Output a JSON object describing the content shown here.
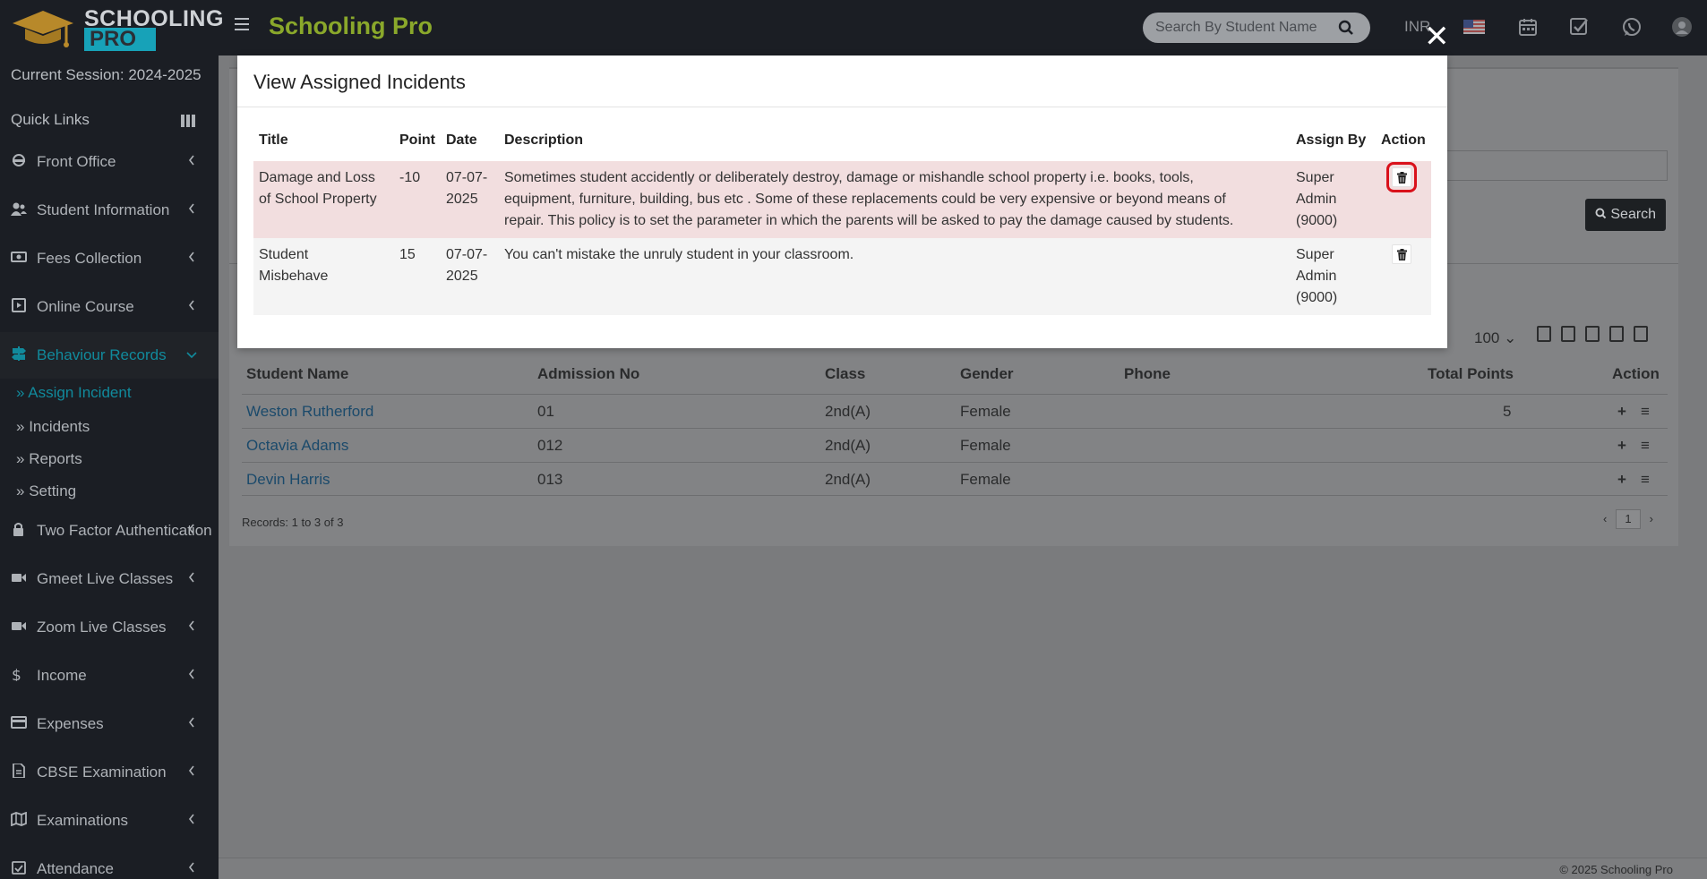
{
  "app": {
    "logo_line1": "SCHOOLING",
    "logo_line2": "PRO",
    "brand": "Schooling Pro",
    "search_placeholder": "Search By Student Name",
    "currency": "INR",
    "icons": [
      "calendar-icon",
      "checklist-icon",
      "whatsapp-icon",
      "user-avatar-icon"
    ]
  },
  "sidebar": {
    "session": "Current Session: 2024-2025",
    "quick_links": "Quick Links",
    "items": [
      {
        "label": "Front Office",
        "icon": "headset-icon"
      },
      {
        "label": "Student Information",
        "icon": "user-group-icon"
      },
      {
        "label": "Fees Collection",
        "icon": "money-icon"
      },
      {
        "label": "Online Course",
        "icon": "video-file-icon"
      },
      {
        "label": "Behaviour Records",
        "icon": "signpost-icon",
        "active": true
      },
      {
        "label": "Two Factor Authentication",
        "icon": "lock-icon"
      },
      {
        "label": "Gmeet Live Classes",
        "icon": "video-camera-icon"
      },
      {
        "label": "Zoom Live Classes",
        "icon": "video-camera-icon"
      },
      {
        "label": "Income",
        "icon": "dollar-icon"
      },
      {
        "label": "Expenses",
        "icon": "credit-card-icon"
      },
      {
        "label": "CBSE Examination",
        "icon": "document-icon"
      },
      {
        "label": "Examinations",
        "icon": "map-icon"
      },
      {
        "label": "Attendance",
        "icon": "calendar-check-icon"
      }
    ],
    "submenu": [
      {
        "label": "Assign Incident",
        "active": true
      },
      {
        "label": "Incidents"
      },
      {
        "label": "Reports"
      },
      {
        "label": "Setting"
      }
    ]
  },
  "background": {
    "search_button": "Search",
    "page_size": "100",
    "columns": [
      "Student Name",
      "Admission No",
      "Class",
      "Gender",
      "Phone",
      "Total Points",
      "Action"
    ],
    "rows": [
      {
        "name": "Weston Rutherford",
        "admission": "01",
        "class": "2nd(A)",
        "gender": "Female",
        "phone": "",
        "points": "5"
      },
      {
        "name": "Octavia Adams",
        "admission": "012",
        "class": "2nd(A)",
        "gender": "Female",
        "phone": "",
        "points": ""
      },
      {
        "name": "Devin Harris",
        "admission": "013",
        "class": "2nd(A)",
        "gender": "Female",
        "phone": "",
        "points": ""
      }
    ],
    "records": "Records: 1 to 3 of 3",
    "page": "1",
    "copyright": "© 2025 Schooling Pro"
  },
  "modal": {
    "title": "View Assigned Incidents",
    "columns": [
      "Title",
      "Point",
      "Date",
      "Description",
      "Assign By",
      "Action"
    ],
    "rows": [
      {
        "title_l1": "Damage and Loss",
        "title_l2": "of School Property",
        "point": "-10",
        "date_l1": "07-07-",
        "date_l2": "2025",
        "desc_l1": "Sometimes student accidently or deliberately destroy, damage or mishandle school property i.e. books, tools,",
        "desc_l2": "equipment, furniture, building, bus etc . Some of these replacements could be very expensive or beyond means of",
        "desc_l3": "repair. This policy is to set the parameter in which the parents will be asked to pay the damage caused by students.",
        "by_l1": "Super",
        "by_l2": "Admin",
        "by_l3": "(9000)"
      },
      {
        "title_l1": "Student",
        "title_l2": "Misbehave",
        "point": "15",
        "date_l1": "07-07-",
        "date_l2": "2025",
        "desc_l1": "You can't mistake the unruly student in your classroom.",
        "desc_l2": "",
        "desc_l3": "",
        "by_l1": "Super",
        "by_l2": "Admin",
        "by_l3": "(9000)"
      }
    ]
  },
  "colors": {
    "header_bg": "#1b1e24",
    "brand": "#8aa82b",
    "accent": "#118a9c",
    "highlight_row": "#f2dedf",
    "highlight_box": "#d9111b"
  }
}
